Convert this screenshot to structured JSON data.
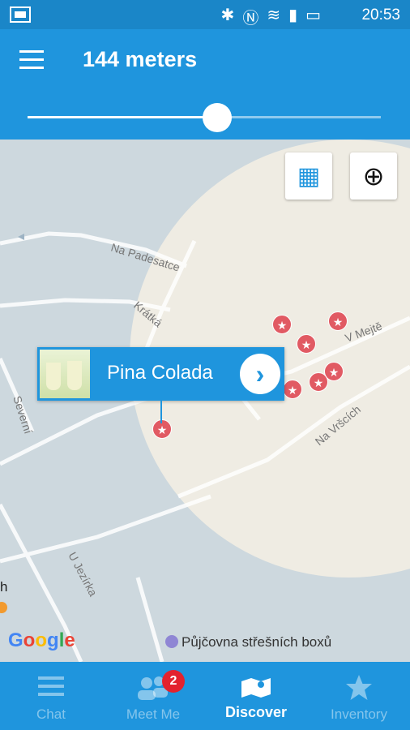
{
  "status": {
    "time": "20:53"
  },
  "appbar": {
    "title": "144 meters"
  },
  "slider": {
    "fraction": 0.536
  },
  "map": {
    "streets": [
      "Na Padesatce",
      "Krátká",
      "V Mejtě",
      "Na Vršcích",
      "Severní",
      "U Jezírka"
    ],
    "edge_text": "h",
    "callout": {
      "name": "Pina Colada",
      "arrow": "›"
    },
    "google": "Google",
    "poi_label": "Půjčovna střešních boxů",
    "marker_glyph": "★"
  },
  "nav": {
    "tabs": [
      {
        "label": "Chat",
        "icon": "chat-icon"
      },
      {
        "label": "Meet Me",
        "icon": "people-icon",
        "badge": "2"
      },
      {
        "label": "Discover",
        "icon": "map-icon"
      },
      {
        "label": "Inventory",
        "icon": "star-icon"
      }
    ],
    "active": "Discover"
  },
  "colors": {
    "primary": "#1f95dd",
    "statusbar": "#1a86c8",
    "marker": "#e15a63",
    "badge": "#e3222e",
    "zone": "#efece3"
  }
}
